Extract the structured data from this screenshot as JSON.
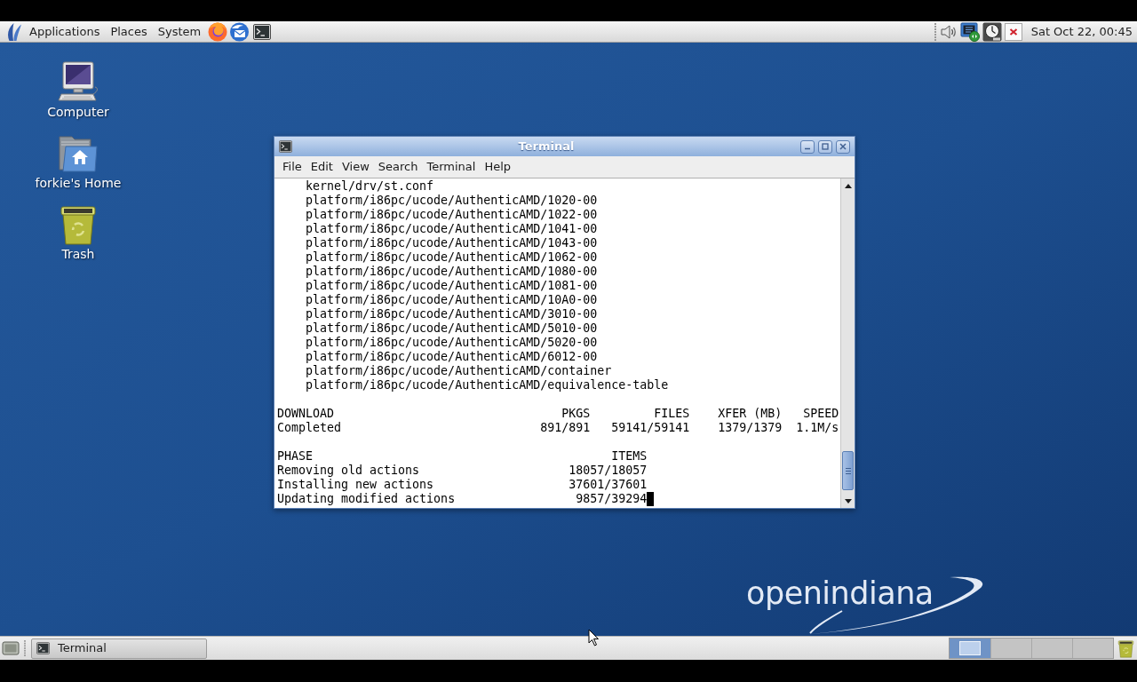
{
  "top_panel": {
    "menus": [
      "Applications",
      "Places",
      "System"
    ],
    "clock": "Sat Oct 22, 00:45"
  },
  "desktop_icons": [
    {
      "kind": "computer",
      "label": "Computer"
    },
    {
      "kind": "home",
      "label": "forkie's Home"
    },
    {
      "kind": "trash",
      "label": "Trash"
    }
  ],
  "terminal_window": {
    "title": "Terminal",
    "menu": [
      "File",
      "Edit",
      "View",
      "Search",
      "Terminal",
      "Help"
    ],
    "file_list": [
      "kernel/drv/st.conf",
      "platform/i86pc/ucode/AuthenticAMD/1020-00",
      "platform/i86pc/ucode/AuthenticAMD/1022-00",
      "platform/i86pc/ucode/AuthenticAMD/1041-00",
      "platform/i86pc/ucode/AuthenticAMD/1043-00",
      "platform/i86pc/ucode/AuthenticAMD/1062-00",
      "platform/i86pc/ucode/AuthenticAMD/1080-00",
      "platform/i86pc/ucode/AuthenticAMD/1081-00",
      "platform/i86pc/ucode/AuthenticAMD/10A0-00",
      "platform/i86pc/ucode/AuthenticAMD/3010-00",
      "platform/i86pc/ucode/AuthenticAMD/5010-00",
      "platform/i86pc/ucode/AuthenticAMD/5020-00",
      "platform/i86pc/ucode/AuthenticAMD/6012-00",
      "platform/i86pc/ucode/AuthenticAMD/container",
      "platform/i86pc/ucode/AuthenticAMD/equivalence-table"
    ],
    "download_table": {
      "columns": [
        "DOWNLOAD",
        "PKGS",
        "FILES",
        "XFER (MB)",
        "SPEED"
      ],
      "rows": [
        [
          "Completed",
          "891/891",
          "59141/59141",
          "1379/1379",
          "1.1M/s"
        ]
      ]
    },
    "phase_table": {
      "columns": [
        "PHASE",
        "ITEMS"
      ],
      "rows": [
        [
          "Removing old actions",
          "18057/18057"
        ],
        [
          "Installing new actions",
          "37601/37601"
        ],
        [
          "Updating modified actions",
          "9857/39294"
        ]
      ]
    }
  },
  "wallpaper": {
    "logo": "openindiana"
  },
  "bottom_panel": {
    "tasks": [
      {
        "label": "Terminal"
      }
    ],
    "workspaces": [
      {
        "selected": true
      },
      {
        "selected": false
      },
      {
        "selected": false
      },
      {
        "selected": false
      }
    ]
  }
}
